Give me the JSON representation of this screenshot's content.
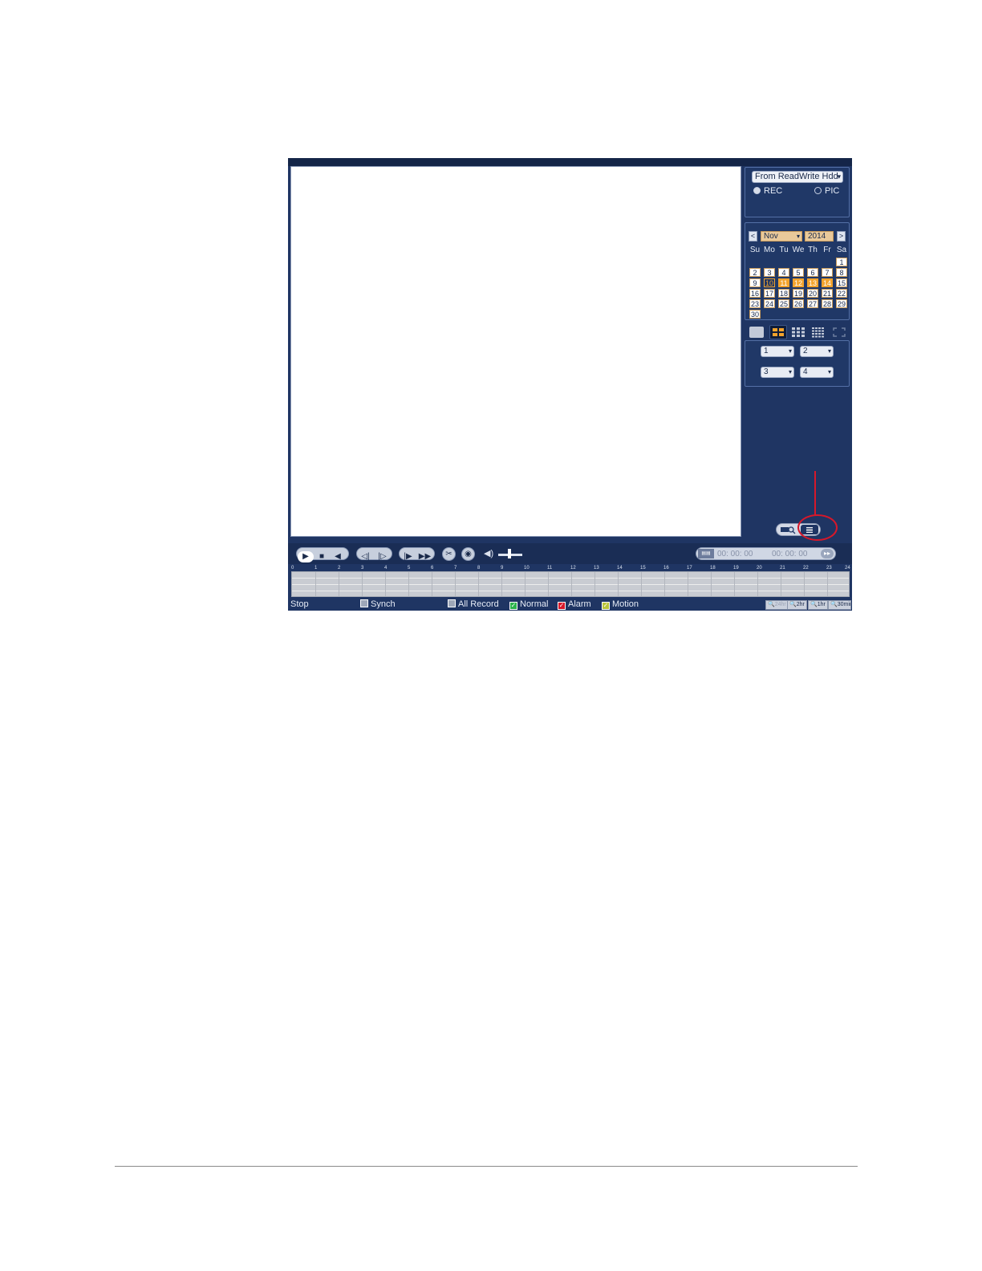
{
  "source": {
    "select_value": "From ReadWrite Hdd",
    "radio_rec": "REC",
    "radio_pic": "PIC",
    "selected": "REC"
  },
  "calendar": {
    "prev": "<",
    "next": ">",
    "month": "Nov",
    "year": "2014",
    "weekdays": [
      "Su",
      "Mo",
      "Tu",
      "We",
      "Th",
      "Fr",
      "Sa"
    ],
    "days": [
      "",
      "",
      "",
      "",
      "",
      "",
      "1",
      "2",
      "3",
      "4",
      "5",
      "6",
      "7",
      "8",
      "9",
      "10",
      "11",
      "12",
      "13",
      "14",
      "15",
      "16",
      "17",
      "18",
      "19",
      "20",
      "21",
      "22",
      "23",
      "24",
      "25",
      "26",
      "27",
      "28",
      "29",
      "30",
      "",
      "",
      "",
      "",
      "",
      ""
    ],
    "recorded_days": [
      "11",
      "12",
      "13",
      "14"
    ],
    "outlined_days": [
      "10"
    ]
  },
  "channels": {
    "ch1": "1",
    "ch2": "2",
    "ch3": "3",
    "ch4": "4"
  },
  "time": {
    "start": "00: 00: 00",
    "end": "00: 00: 00"
  },
  "hours": [
    "0",
    "1",
    "2",
    "3",
    "4",
    "5",
    "6",
    "7",
    "8",
    "9",
    "10",
    "11",
    "12",
    "13",
    "14",
    "15",
    "16",
    "17",
    "18",
    "19",
    "20",
    "21",
    "22",
    "23",
    "24"
  ],
  "legend": {
    "stop": "Stop",
    "synch": "Synch",
    "all_record": "All Record",
    "normal": "Normal",
    "alarm": "Alarm",
    "motion": "Motion"
  },
  "zoom": {
    "z24": "24hr",
    "z2": "2hr",
    "z1": "1hr",
    "z30": "30min"
  },
  "colors": {
    "panel_bg": "#1f3563",
    "recorded_day": "#f3a32c",
    "normal": "#2bb24c",
    "alarm": "#d6182a",
    "motion": "#b9c43a",
    "callout": "#d6182a"
  }
}
